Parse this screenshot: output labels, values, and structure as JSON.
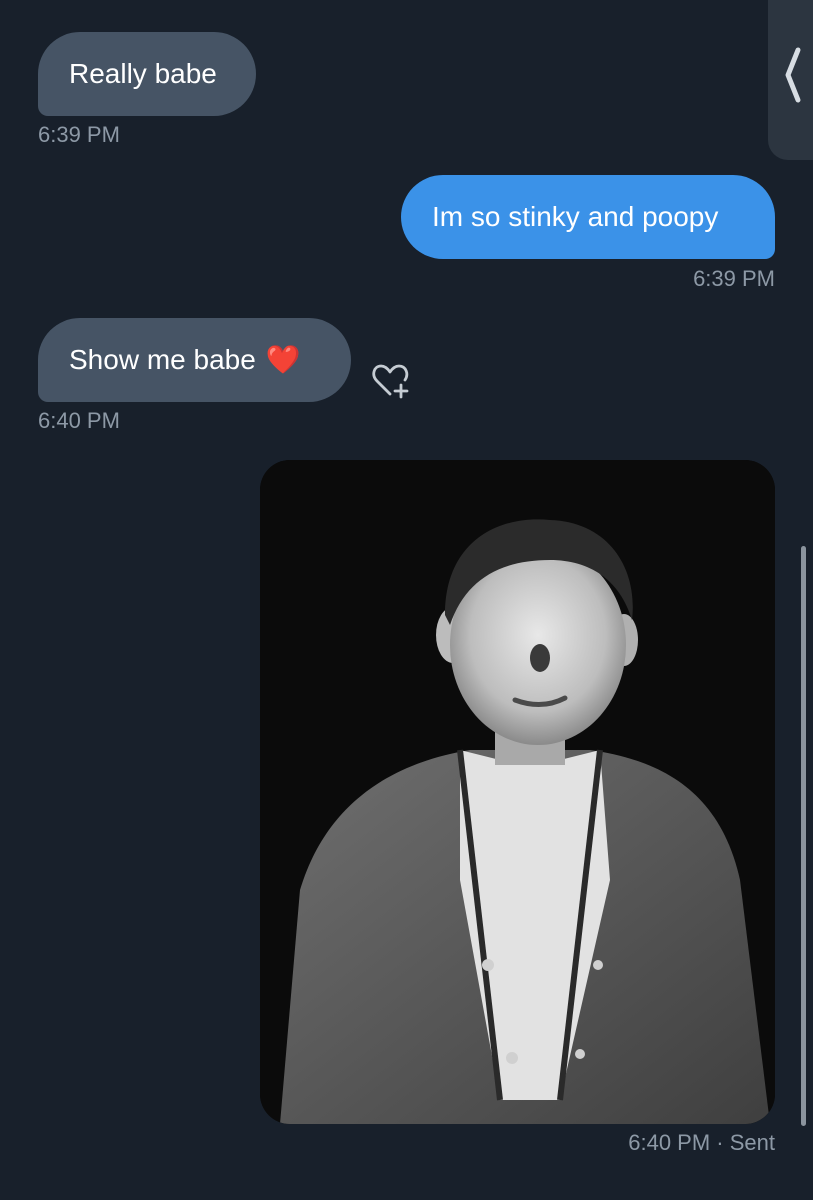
{
  "messages": [
    {
      "text": "Really babe",
      "time": "6:39 PM"
    },
    {
      "text": "Im so stinky and poopy",
      "time": "6:39 PM"
    },
    {
      "text": "Show me babe",
      "emoji": "❤️",
      "time": "6:40 PM"
    },
    {
      "time": "6:40 PM",
      "status": "· Sent"
    }
  ],
  "icons": {
    "collapse": "chevron-left-icon",
    "react": "heart-add-icon",
    "heart_emoji": "❤"
  },
  "colors": {
    "background": "#18202b",
    "incoming_bubble": "#465465",
    "outgoing_bubble": "#3b92e8",
    "timestamp": "#8d99a6"
  }
}
